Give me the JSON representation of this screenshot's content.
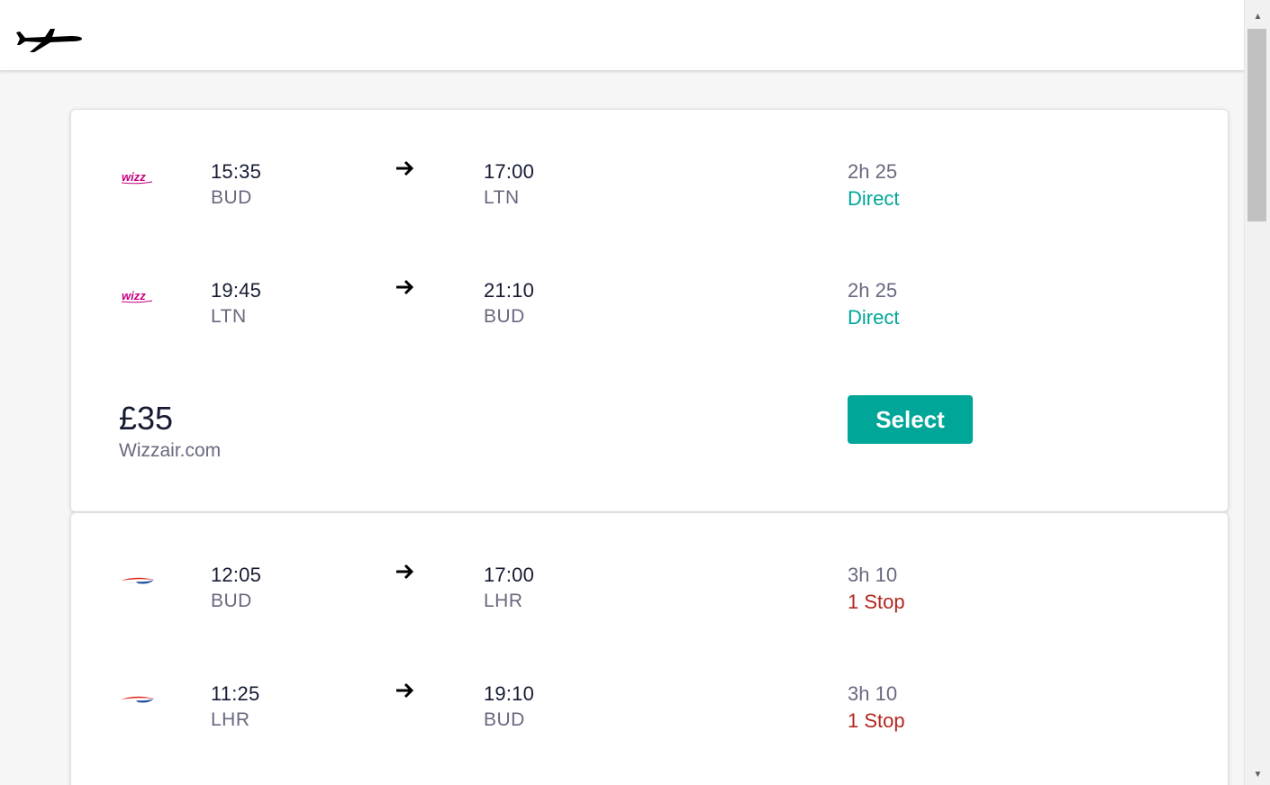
{
  "header": {
    "logo_icon": "airplane-icon"
  },
  "results": [
    {
      "legs": [
        {
          "airline_icon": "wizzair-logo-icon",
          "depart_time": "15:35",
          "depart_code": "BUD",
          "arrive_time": "17:00",
          "arrive_code": "LTN",
          "duration": "2h 25",
          "stops": "Direct"
        },
        {
          "airline_icon": "wizzair-logo-icon",
          "depart_time": "19:45",
          "depart_code": "LTN",
          "arrive_time": "21:10",
          "arrive_code": "BUD",
          "duration": "2h 25",
          "stops": "Direct"
        }
      ],
      "price": "£35",
      "provider": "Wizzair.com",
      "select_label": "Select"
    },
    {
      "legs": [
        {
          "airline_icon": "british-airways-logo-icon",
          "depart_time": "12:05",
          "depart_code": "BUD",
          "arrive_time": "17:00",
          "arrive_code": "LHR",
          "duration": "3h 10",
          "stops": "1 Stop"
        },
        {
          "airline_icon": "british-airways-logo-icon",
          "depart_time": "11:25",
          "depart_code": "LHR",
          "arrive_time": "19:10",
          "arrive_code": "BUD",
          "duration": "3h 10",
          "stops": "1 Stop"
        }
      ]
    }
  ],
  "colors": {
    "accent": "#00a698",
    "direct": "#00a698",
    "stop": "#b3261e",
    "primary_text": "#161b33",
    "secondary_text": "#68697f"
  }
}
